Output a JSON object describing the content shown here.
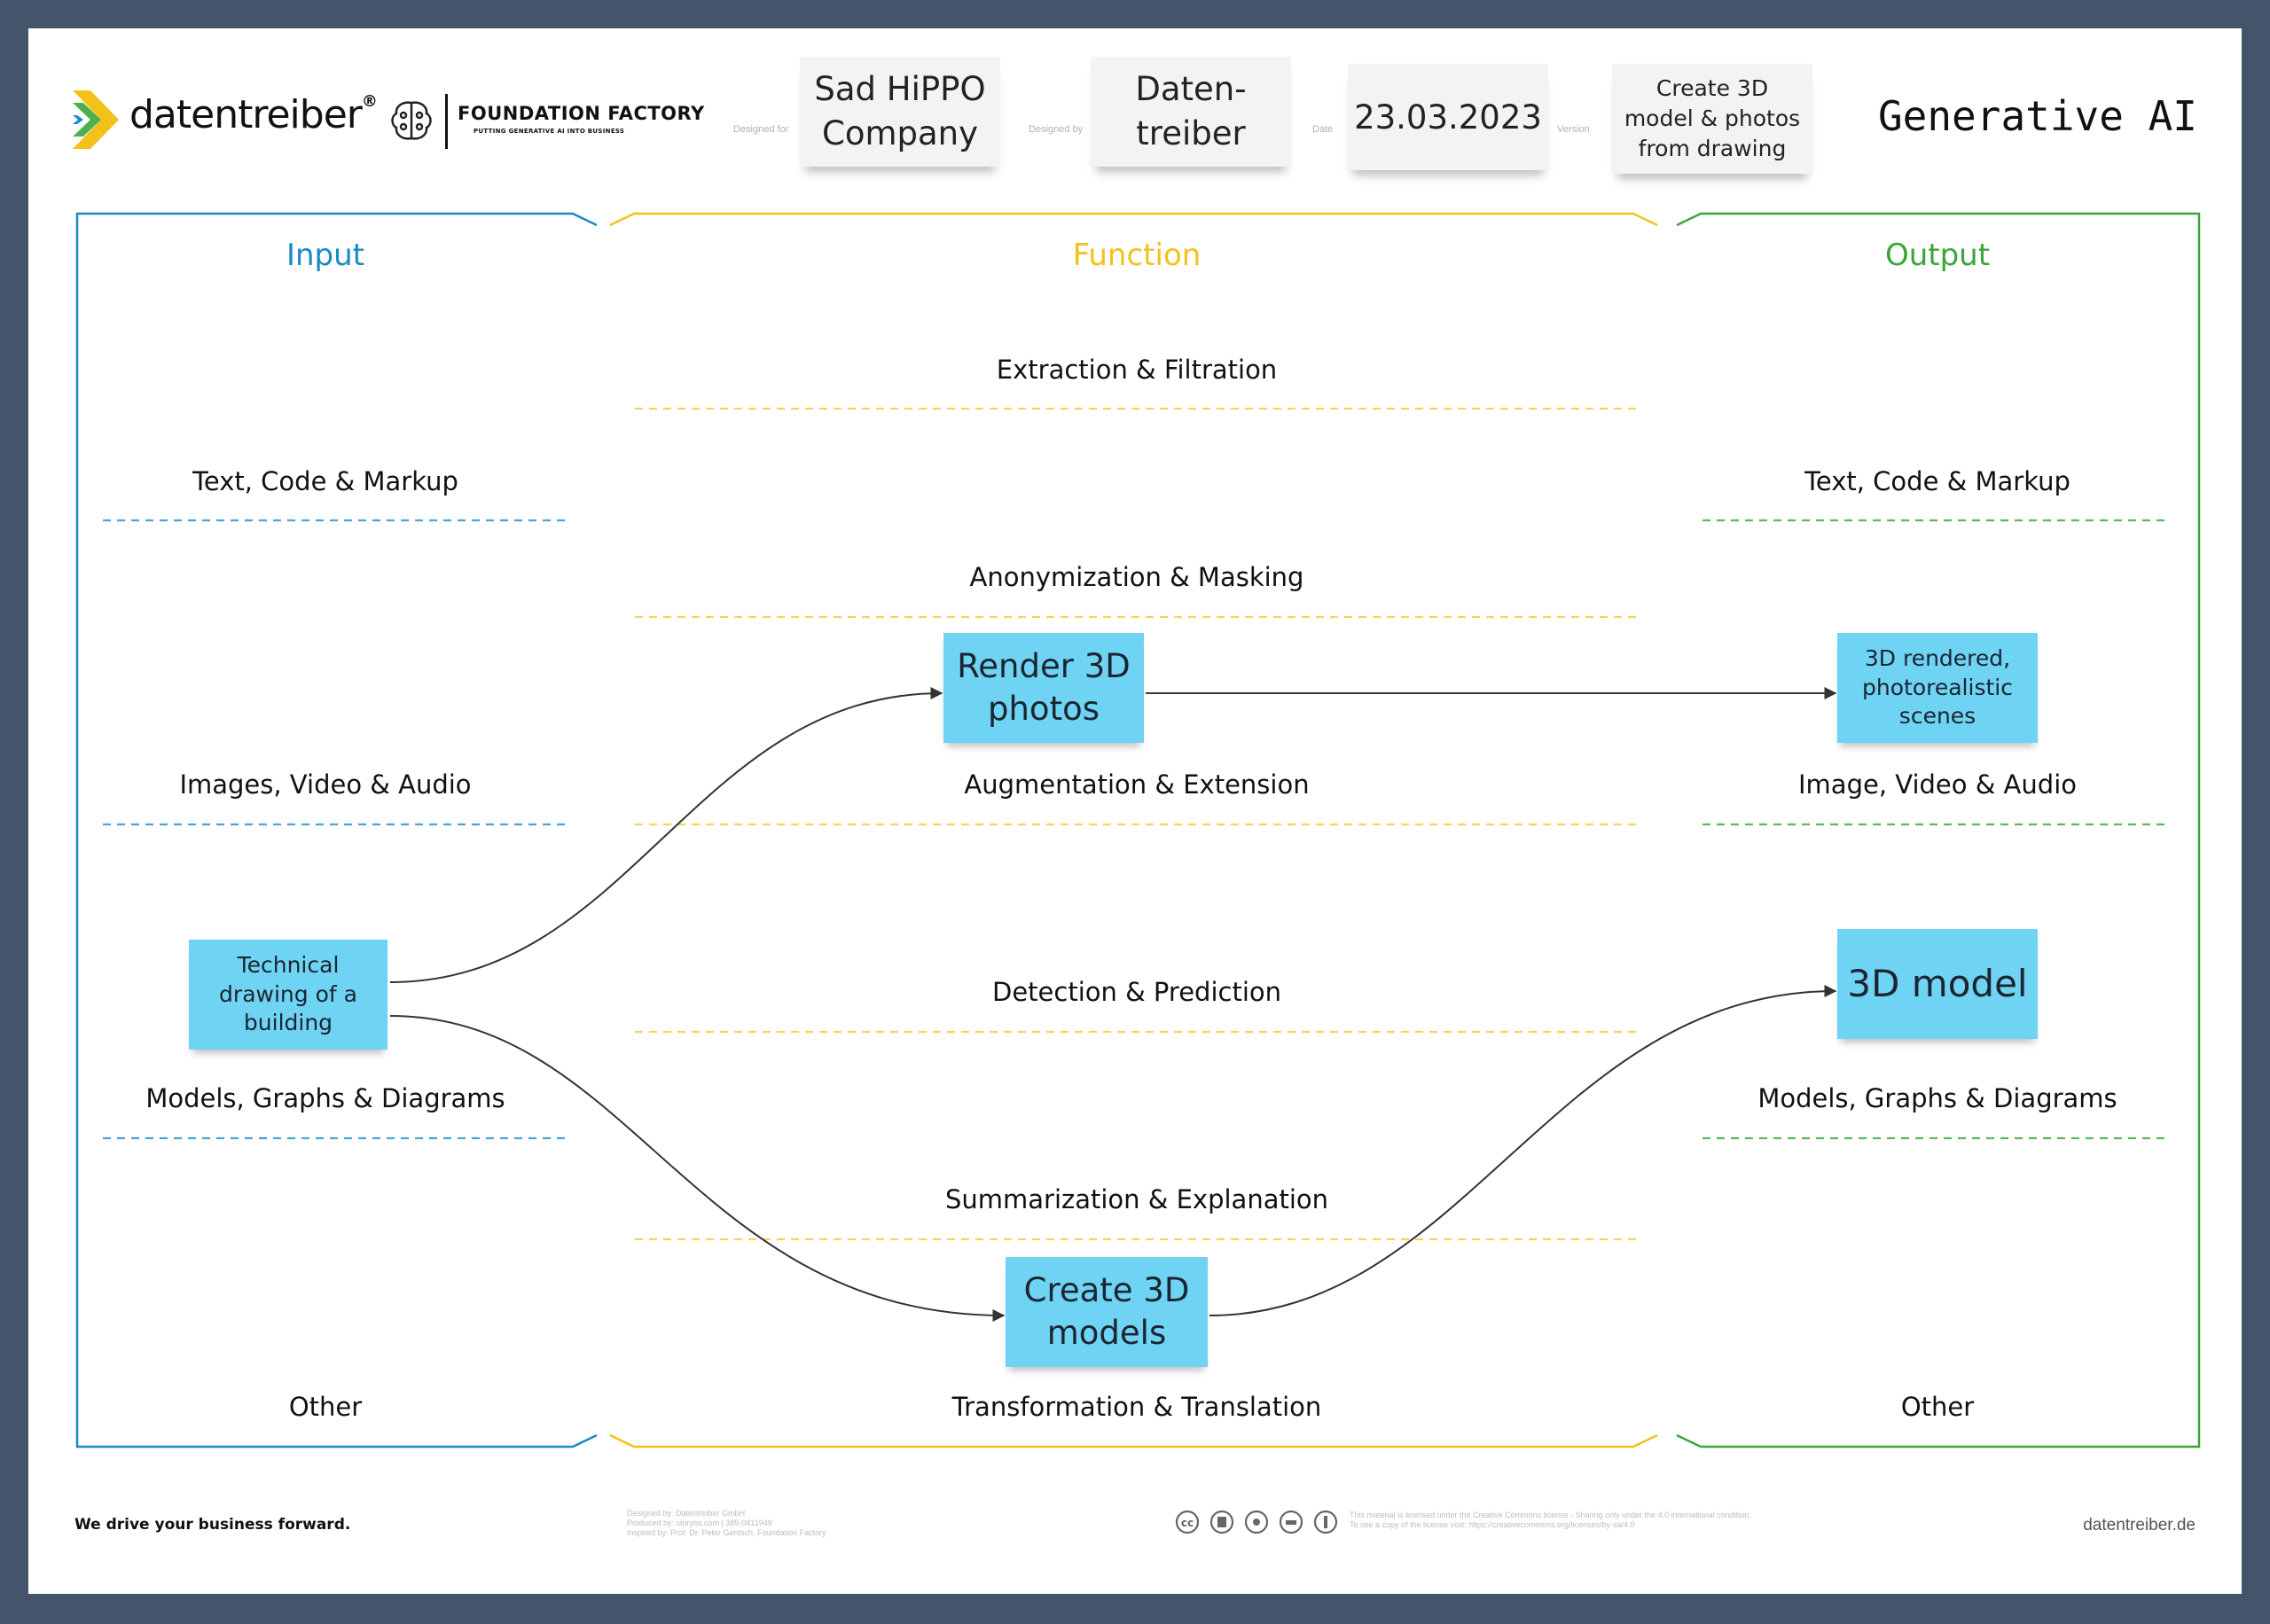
{
  "header": {
    "logo_brand": "datentreiber",
    "logo_reg": "®",
    "partner_title": "FOUNDATION FACTORY",
    "partner_subtitle": "PUTTING GENERATIVE AI INTO BUSINESS",
    "designed_for_label": "Designed for",
    "designed_for_value": "Sad HiPPO Company",
    "designed_by_label": "Designed by",
    "designed_by_value": "Daten-treiber",
    "date_label": "Date",
    "date_value": "23.03.2023",
    "version_label": "Version",
    "version_value": "Create 3D model & photos from drawing",
    "canvas_title": "Generative AI"
  },
  "columns": {
    "input": {
      "title": "Input",
      "color": "#1a8ac4"
    },
    "function": {
      "title": "Function",
      "color": "#f2c21b"
    },
    "output": {
      "title": "Output",
      "color": "#3aa63a"
    }
  },
  "input_categories": [
    "Text, Code & Markup",
    "Images, Video & Audio",
    "Models, Graphs & Diagrams",
    "Other"
  ],
  "function_categories": [
    "Extraction & Filtration",
    "Anonymization & Masking",
    "Augmentation & Extension",
    "Detection & Prediction",
    "Summarization & Explanation",
    "Transformation & Translation"
  ],
  "output_categories": [
    "Text, Code & Markup",
    "Image, Video & Audio",
    "Models, Graphs & Diagrams",
    "Other"
  ],
  "notes": {
    "input_drawing": "Technical drawing of a building",
    "func_render": "Render 3D photos",
    "func_create": "Create 3D models",
    "out_scenes": "3D rendered, photorealistic scenes",
    "out_model": "3D model"
  },
  "footer": {
    "slogan": "We drive your business forward.",
    "credits_1": "Designed by: Datentreiber GmbH",
    "credits_2": "Produced by: storyos.com | 385-0411949",
    "credits_3": "Inspired by: Prof. Dr. Peter Gentsch, Foundation Factory",
    "license_1": "This material is licensed under the Creative Commons license - Sharing only under the 4.0 international condition.",
    "license_2": "To see a copy of the license visit: https://creativecommons.org/licenses/by-sa/4.0",
    "website": "datentreiber.de"
  },
  "icons": [
    "datentreiber-logo-icon",
    "brain-icon",
    "cc-icon",
    "cc-by-icon",
    "cc-sa-icon",
    "cc-nc-icon",
    "cc-info-icon"
  ]
}
